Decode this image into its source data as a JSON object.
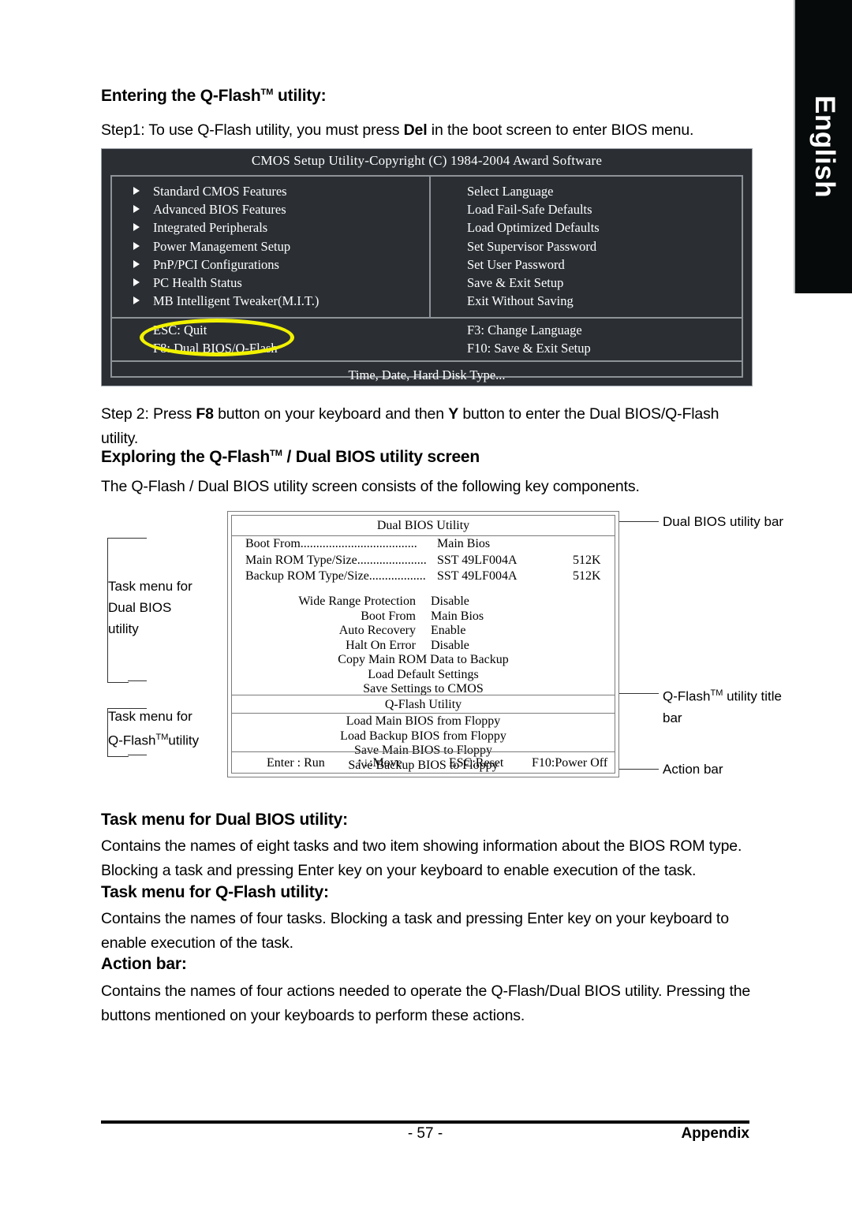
{
  "lang_tab": {
    "label": "English"
  },
  "headings": {
    "entering": "Entering the Q-Flash",
    "entering_sup": "TM",
    "entering_tail": " utility:",
    "exploring_a": "Exploring the Q-Flash",
    "exploring_sup": "TM",
    "exploring_b": " / Dual BIOS utility screen",
    "task_dual": "Task menu for Dual BIOS utility:",
    "task_qflash": "Task menu for Q-Flash utility:",
    "action_bar": "Action bar:"
  },
  "paragraphs": {
    "step1_a": "Step1: To use Q-Flash utility, you must press ",
    "step1_key": "Del",
    "step1_b": " in the boot screen to enter BIOS menu.",
    "step2_a": "Step 2: Press ",
    "step2_key1": "F8",
    "step2_b": " button on your keyboard and then ",
    "step2_key2": "Y",
    "step2_c": " button to enter the Dual BIOS/Q-Flash utility.",
    "explore": "The Q-Flash / Dual BIOS utility screen consists of the following key components.",
    "task_dual_body": "Contains the names of eight tasks and two item showing information about the BIOS ROM type. Blocking a task and pressing Enter key on your keyboard to enable execution of the task.",
    "task_qflash_body": "Contains the names of four tasks. Blocking a task and pressing Enter key on your keyboard to enable execution of the task.",
    "action_bar_body": "Contains the names of four actions needed to operate the Q-Flash/Dual BIOS utility. Pressing the buttons mentioned on your keyboards to perform these actions."
  },
  "bios_screen": {
    "title": "CMOS Setup Utility-Copyright (C) 1984-2004 Award Software",
    "left_items": [
      "Standard CMOS Features",
      "Advanced BIOS Features",
      "Integrated Peripherals",
      "Power Management Setup",
      "PnP/PCI Configurations",
      "PC Health Status",
      "MB Intelligent Tweaker(M.I.T.)"
    ],
    "right_items": [
      "Select Language",
      "Load Fail-Safe Defaults",
      "Load Optimized Defaults",
      "Set Supervisor Password",
      "Set User Password",
      "Save & Exit Setup",
      "Exit Without Saving"
    ],
    "key_left_1": "ESC: Quit",
    "key_left_2": "F8: Dual BIOS/Q-Flash",
    "key_right_1": "F3: Change Language",
    "key_right_2": "F10: Save & Exit Setup",
    "footer": "Time, Date, Hard Disk Type...",
    "highlight_color": "#f2f200",
    "background_color": "#2b2f34"
  },
  "diagram": {
    "dual_bios_title": "Dual BIOS Utility",
    "rom_rows": [
      {
        "label": "Boot From.....................................",
        "value": "Main Bios",
        "size": ""
      },
      {
        "label": "Main ROM Type/Size......................",
        "value": "SST 49LF004A",
        "size": "512K"
      },
      {
        "label": "Backup ROM Type/Size..................",
        "value": "SST 49LF004A",
        "size": "512K"
      }
    ],
    "dual_tasks": [
      {
        "name": "Wide Range Protection",
        "value": "Disable"
      },
      {
        "name": "Boot From",
        "value": "Main Bios"
      },
      {
        "name": "Auto Recovery",
        "value": "Enable"
      },
      {
        "name": "Halt On Error",
        "value": "Disable"
      },
      {
        "name": "Copy Main ROM Data to Backup",
        "value": ""
      },
      {
        "name": "Load Default Settings",
        "value": ""
      },
      {
        "name": "Save Settings to CMOS",
        "value": ""
      }
    ],
    "qflash_title": "Q-Flash Utility",
    "qflash_tasks": [
      "Load Main BIOS from Floppy",
      "Load Backup BIOS from Floppy",
      "Save Main BIOS to Floppy",
      "Save Backup BIOS to Floppy"
    ],
    "actions": [
      "Enter : Run",
      "↑↓:Move",
      "ESC:Reset",
      "F10:Power Off"
    ],
    "callouts": {
      "dual_bios_bar": "Dual BIOS utility bar",
      "task_menu_dual_l1": "Task menu for",
      "task_menu_dual_l2": "Dual BIOS",
      "task_menu_dual_l3": "utility",
      "task_menu_qf_l1": "Task menu for",
      "task_menu_qf_l2a": "Q-Flash",
      "task_menu_qf_sup": "TM",
      "task_menu_qf_l2b": "utility",
      "qflash_title_bar_l1a": "Q-Flash",
      "qflash_title_bar_sup": "TM",
      "qflash_title_bar_l1b": " utility title",
      "qflash_title_bar_l2": "bar",
      "action_bar": "Action bar"
    }
  },
  "footer": {
    "page_number": "- 57 -",
    "section": "Appendix"
  }
}
